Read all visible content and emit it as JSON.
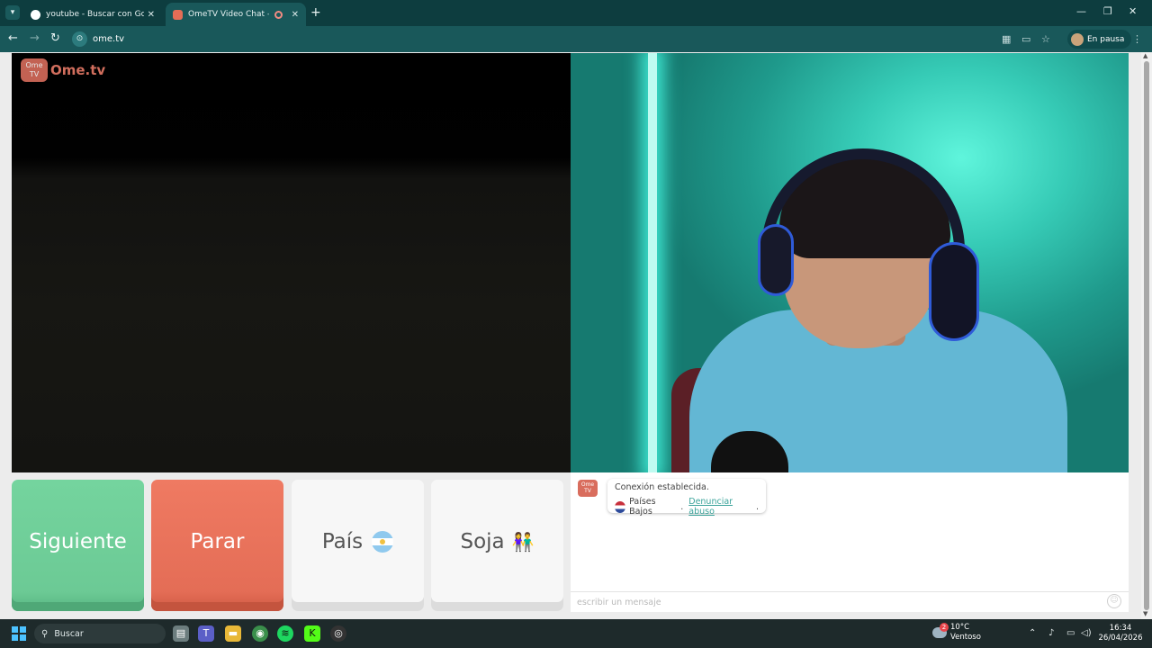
{
  "browser": {
    "tabs": [
      {
        "title": "youtube - Buscar con Google",
        "active": false
      },
      {
        "title": "OmeTV Video Chat — Alter",
        "active": true
      }
    ],
    "url": "ome.tv",
    "profile_label": "En pausa"
  },
  "brand": {
    "logo_text": "Ome.tv",
    "logo_badge": "Ome TV"
  },
  "controls": {
    "next_label": "Siguiente",
    "stop_label": "Parar",
    "country_label": "País",
    "gender_label": "Soja"
  },
  "chat": {
    "status": "Conexión establecida.",
    "country": "Países Bajos",
    "separator": " . ",
    "report_link": "Denunciar abuso",
    "report_suffix": ".",
    "input_placeholder": "escribir un mensaje"
  },
  "taskbar": {
    "search_placeholder": "Buscar",
    "weather_temp": "10°C",
    "weather_desc": "Ventoso",
    "weather_badge": "2",
    "time": "16:34",
    "date": "26/04/2026"
  },
  "colors": {
    "next": "#6cca95",
    "stop": "#e46d56",
    "link": "#3aa39a",
    "browser_chrome": "#19585a"
  }
}
